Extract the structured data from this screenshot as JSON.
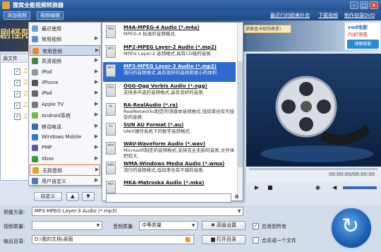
{
  "window": {
    "title": "狸窝全能视频转换器",
    "min": "–",
    "max": "□",
    "close": "×"
  },
  "toolbar": {
    "add_video": "添加视频",
    "video_edit": "视频编辑",
    "link_recent": "最近行的欧美扑克",
    "link_download": "下载视频",
    "link_dvd": "制作刻录DVD"
  },
  "banner": {
    "ad_text": "求索金卡给的南手!",
    "vod_brand": "vod电影",
    "vod_sub": "内涵T观看",
    "vod_button": "理解观影"
  },
  "file_list": {
    "header": "源文件",
    "rows": [
      "",
      "",
      "",
      "",
      "",
      "",
      "",
      ""
    ]
  },
  "menu1": {
    "items": [
      {
        "label": "最近使用",
        "icon_color": "#6aa0d8"
      },
      {
        "label": "常用视频",
        "icon_color": "#5a8fd0"
      },
      {
        "label": "常用音频",
        "icon_color": "#e08a2a"
      },
      {
        "label": "高清视频",
        "icon_color": "#3a8a3a"
      },
      {
        "label": "iPod",
        "icon_color": "#999999"
      },
      {
        "label": "iPhone",
        "icon_color": "#555555"
      },
      {
        "label": "iPad",
        "icon_color": "#666666"
      },
      {
        "label": "Apple TV",
        "icon_color": "#777777"
      },
      {
        "label": "Android系统",
        "icon_color": "#78b842"
      },
      {
        "label": "移动电话",
        "icon_color": "#3a6ab0"
      },
      {
        "label": "Windows Mobile",
        "icon_color": "#2a7ad0"
      },
      {
        "label": "PMP",
        "icon_color": "#5a5a9a"
      },
      {
        "label": "Xbox",
        "icon_color": "#3a9a3a"
      },
      {
        "label": "无损音频",
        "icon_color": "#e0a020"
      },
      {
        "label": "用户自定义",
        "icon_color": "#4a7ab0"
      }
    ],
    "arrow": "▶",
    "custom_button": "自定义"
  },
  "menu2": {
    "items": [
      {
        "icon": "M4A",
        "name": "M4A-MPEG-4 Audio (*.m4a)",
        "desc": "MPEG-4 标准的音频格式."
      },
      {
        "icon": "MP2",
        "name": "MP2-MPEG Layer-2 Audio (*.mp2)",
        "desc": "MPEG Layer-2 音频格式,具有CD级的音质."
      },
      {
        "icon": "MP3",
        "name": "MP3-MPEG Layer-3 Audio (*.mp3)",
        "desc": "流行的音频格式,具有很好的音质和很小的体积."
      },
      {
        "icon": "OGG",
        "name": "OGG-Ogg Vorbis Audio (*.ogg)",
        "desc": "支持多声道的音频格式,具有良好的音质."
      },
      {
        "icon": "RA",
        "name": "RA-RealAudio (*.ra)",
        "desc": "RealNetworks制定的流媒体音频格式,低码率也有可接受的音质."
      },
      {
        "icon": "AU",
        "name": "SUN AU Format (*.au)",
        "desc": "UNIX操作系统下的数字音频格式."
      },
      {
        "icon": "WAV",
        "name": "WAV-Waveform Audio (*.wav)",
        "desc": "Microsoft制定的音频格式,支持完全无损的音质,文件体积较大."
      },
      {
        "icon": "WMA",
        "name": "WMA-Windows Media Audio (*.wma)",
        "desc": "流行的音频格式,低码率也有不错的音质."
      },
      {
        "icon": "MKA",
        "name": "MKA-Matroska Audio (*.mka)",
        "desc": ""
      }
    ]
  },
  "player": {
    "timecode": "00:00:00/00:00:00"
  },
  "settings": {
    "preset_label": "预置方案:",
    "preset_value": "MP3-MPEG Layer-3 Audio (*.mp3)",
    "video_quality_label": "视频质量:",
    "video_quality_value": "",
    "audio_quality_label": "音频质量:",
    "audio_quality_value": "中等质量",
    "advanced_button": "高级设置",
    "apply_all": "应用到所有",
    "output_label": "输出目录:",
    "output_value": "D:\\我的文档\\桌面",
    "open_dir_button": "打开目录",
    "merge": "合并成一个文件"
  }
}
